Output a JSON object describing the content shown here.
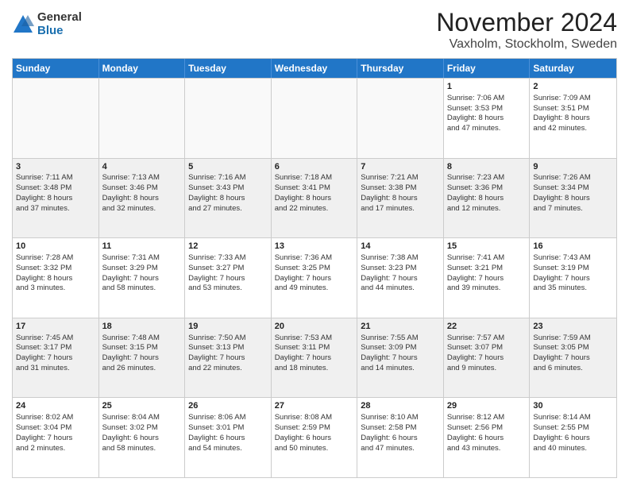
{
  "logo": {
    "general": "General",
    "blue": "Blue"
  },
  "title": "November 2024",
  "location": "Vaxholm, Stockholm, Sweden",
  "headers": [
    "Sunday",
    "Monday",
    "Tuesday",
    "Wednesday",
    "Thursday",
    "Friday",
    "Saturday"
  ],
  "rows": [
    [
      {
        "day": "",
        "empty": true
      },
      {
        "day": "",
        "empty": true
      },
      {
        "day": "",
        "empty": true
      },
      {
        "day": "",
        "empty": true
      },
      {
        "day": "",
        "empty": true
      },
      {
        "day": "1",
        "sunrise": "Sunrise: 7:06 AM",
        "sunset": "Sunset: 3:53 PM",
        "daylight": "Daylight: 8 hours and 47 minutes."
      },
      {
        "day": "2",
        "sunrise": "Sunrise: 7:09 AM",
        "sunset": "Sunset: 3:51 PM",
        "daylight": "Daylight: 8 hours and 42 minutes."
      }
    ],
    [
      {
        "day": "3",
        "sunrise": "Sunrise: 7:11 AM",
        "sunset": "Sunset: 3:48 PM",
        "daylight": "Daylight: 8 hours and 37 minutes."
      },
      {
        "day": "4",
        "sunrise": "Sunrise: 7:13 AM",
        "sunset": "Sunset: 3:46 PM",
        "daylight": "Daylight: 8 hours and 32 minutes."
      },
      {
        "day": "5",
        "sunrise": "Sunrise: 7:16 AM",
        "sunset": "Sunset: 3:43 PM",
        "daylight": "Daylight: 8 hours and 27 minutes."
      },
      {
        "day": "6",
        "sunrise": "Sunrise: 7:18 AM",
        "sunset": "Sunset: 3:41 PM",
        "daylight": "Daylight: 8 hours and 22 minutes."
      },
      {
        "day": "7",
        "sunrise": "Sunrise: 7:21 AM",
        "sunset": "Sunset: 3:38 PM",
        "daylight": "Daylight: 8 hours and 17 minutes."
      },
      {
        "day": "8",
        "sunrise": "Sunrise: 7:23 AM",
        "sunset": "Sunset: 3:36 PM",
        "daylight": "Daylight: 8 hours and 12 minutes."
      },
      {
        "day": "9",
        "sunrise": "Sunrise: 7:26 AM",
        "sunset": "Sunset: 3:34 PM",
        "daylight": "Daylight: 8 hours and 7 minutes."
      }
    ],
    [
      {
        "day": "10",
        "sunrise": "Sunrise: 7:28 AM",
        "sunset": "Sunset: 3:32 PM",
        "daylight": "Daylight: 8 hours and 3 minutes."
      },
      {
        "day": "11",
        "sunrise": "Sunrise: 7:31 AM",
        "sunset": "Sunset: 3:29 PM",
        "daylight": "Daylight: 7 hours and 58 minutes."
      },
      {
        "day": "12",
        "sunrise": "Sunrise: 7:33 AM",
        "sunset": "Sunset: 3:27 PM",
        "daylight": "Daylight: 7 hours and 53 minutes."
      },
      {
        "day": "13",
        "sunrise": "Sunrise: 7:36 AM",
        "sunset": "Sunset: 3:25 PM",
        "daylight": "Daylight: 7 hours and 49 minutes."
      },
      {
        "day": "14",
        "sunrise": "Sunrise: 7:38 AM",
        "sunset": "Sunset: 3:23 PM",
        "daylight": "Daylight: 7 hours and 44 minutes."
      },
      {
        "day": "15",
        "sunrise": "Sunrise: 7:41 AM",
        "sunset": "Sunset: 3:21 PM",
        "daylight": "Daylight: 7 hours and 39 minutes."
      },
      {
        "day": "16",
        "sunrise": "Sunrise: 7:43 AM",
        "sunset": "Sunset: 3:19 PM",
        "daylight": "Daylight: 7 hours and 35 minutes."
      }
    ],
    [
      {
        "day": "17",
        "sunrise": "Sunrise: 7:45 AM",
        "sunset": "Sunset: 3:17 PM",
        "daylight": "Daylight: 7 hours and 31 minutes."
      },
      {
        "day": "18",
        "sunrise": "Sunrise: 7:48 AM",
        "sunset": "Sunset: 3:15 PM",
        "daylight": "Daylight: 7 hours and 26 minutes."
      },
      {
        "day": "19",
        "sunrise": "Sunrise: 7:50 AM",
        "sunset": "Sunset: 3:13 PM",
        "daylight": "Daylight: 7 hours and 22 minutes."
      },
      {
        "day": "20",
        "sunrise": "Sunrise: 7:53 AM",
        "sunset": "Sunset: 3:11 PM",
        "daylight": "Daylight: 7 hours and 18 minutes."
      },
      {
        "day": "21",
        "sunrise": "Sunrise: 7:55 AM",
        "sunset": "Sunset: 3:09 PM",
        "daylight": "Daylight: 7 hours and 14 minutes."
      },
      {
        "day": "22",
        "sunrise": "Sunrise: 7:57 AM",
        "sunset": "Sunset: 3:07 PM",
        "daylight": "Daylight: 7 hours and 9 minutes."
      },
      {
        "day": "23",
        "sunrise": "Sunrise: 7:59 AM",
        "sunset": "Sunset: 3:05 PM",
        "daylight": "Daylight: 7 hours and 6 minutes."
      }
    ],
    [
      {
        "day": "24",
        "sunrise": "Sunrise: 8:02 AM",
        "sunset": "Sunset: 3:04 PM",
        "daylight": "Daylight: 7 hours and 2 minutes."
      },
      {
        "day": "25",
        "sunrise": "Sunrise: 8:04 AM",
        "sunset": "Sunset: 3:02 PM",
        "daylight": "Daylight: 6 hours and 58 minutes."
      },
      {
        "day": "26",
        "sunrise": "Sunrise: 8:06 AM",
        "sunset": "Sunset: 3:01 PM",
        "daylight": "Daylight: 6 hours and 54 minutes."
      },
      {
        "day": "27",
        "sunrise": "Sunrise: 8:08 AM",
        "sunset": "Sunset: 2:59 PM",
        "daylight": "Daylight: 6 hours and 50 minutes."
      },
      {
        "day": "28",
        "sunrise": "Sunrise: 8:10 AM",
        "sunset": "Sunset: 2:58 PM",
        "daylight": "Daylight: 6 hours and 47 minutes."
      },
      {
        "day": "29",
        "sunrise": "Sunrise: 8:12 AM",
        "sunset": "Sunset: 2:56 PM",
        "daylight": "Daylight: 6 hours and 43 minutes."
      },
      {
        "day": "30",
        "sunrise": "Sunrise: 8:14 AM",
        "sunset": "Sunset: 2:55 PM",
        "daylight": "Daylight: 6 hours and 40 minutes."
      }
    ]
  ]
}
